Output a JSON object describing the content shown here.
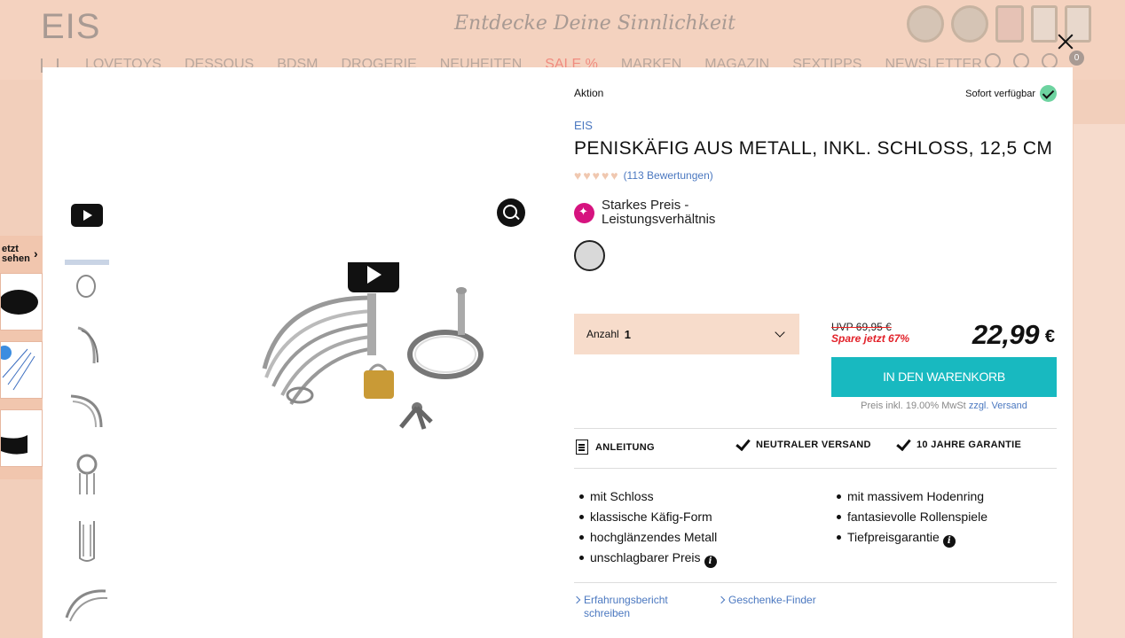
{
  "site": {
    "logo": "EIS",
    "slogan": "Entdecke Deine Sinnlichkeit",
    "nav": [
      "LOVETOYS",
      "DESSOUS",
      "BDSM",
      "DROGERIE",
      "NEUHEITEN",
      "SALE %",
      "MARKEN",
      "MAGAZIN",
      "SEXTIPPS",
      "NEWSLETTER"
    ],
    "cart_count": "0"
  },
  "side_strip": {
    "title_line1": "etzt",
    "title_line2": "sehen"
  },
  "product": {
    "badge": "Aktion",
    "availability": "Sofort verfügbar",
    "brand": "EIS",
    "title": "PENISKÄFIG AUS METALL, INKL. SCHLOSS, 12,5 CM",
    "rating_stars": 4.5,
    "rating_text": "(113 Bewertungen)",
    "feature_line1": "Starkes Preis -",
    "feature_line2": "Leistungsverhältnis",
    "quantity_label": "Anzahl",
    "quantity_value": "1",
    "uvp": "UVP 69,95 €",
    "savings": "Spare jetzt 67%",
    "price": "22,99",
    "currency": "€",
    "cart_button": "IN DEN WARENKORB",
    "vat_text": "Preis inkl. 19.00% MwSt",
    "vat_link": "zzgl. Versand",
    "usps": [
      "ANLEITUNG",
      "NEUTRALER VERSAND",
      "10 JAHRE GARANTIE"
    ],
    "bullets_left": [
      "mit Schloss",
      "klassische Käfig-Form",
      "hochglänzendes Metall",
      "unschlagbarer Preis"
    ],
    "bullets_right": [
      "mit massivem Hodenring",
      "fantasievolle Rollenspiele",
      "Tiefpreisgarantie"
    ],
    "link_review_line1": "Erfahrungsbericht",
    "link_review_line2": "schreiben",
    "link_gift": "Geschenke-Finder"
  },
  "colors": {
    "accent_teal": "#18b9c0",
    "sale_red": "#e2222a",
    "link_blue": "#4b78c0",
    "brand_pink": "#d6137f"
  }
}
